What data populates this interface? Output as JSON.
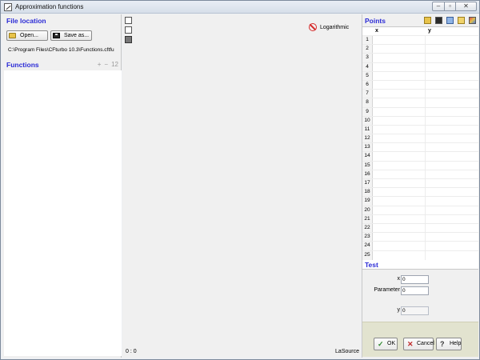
{
  "window": {
    "title": "Approximation functions"
  },
  "file_location": {
    "title": "File location",
    "open_label": "Open...",
    "save_label": "Save as...",
    "path": "C:\\Program Files\\CFturbo 10.3\\Functions.cftfu"
  },
  "functions": {
    "title": "Functions",
    "tools": {
      "add": "+",
      "remove": "−",
      "sort": "12"
    }
  },
  "plot": {
    "log_label": "Logarithmic",
    "coords": "0 : 0",
    "source": "LaSource"
  },
  "points": {
    "title": "Points",
    "col_x": "x",
    "col_y": "y",
    "rows": [
      "1",
      "2",
      "3",
      "4",
      "5",
      "6",
      "7",
      "8",
      "9",
      "10",
      "11",
      "12",
      "13",
      "14",
      "15",
      "16",
      "17",
      "18",
      "19",
      "20",
      "21",
      "22",
      "23",
      "24",
      "25"
    ]
  },
  "test": {
    "title": "Test",
    "x_label": "x",
    "x_value": "0",
    "param_label": "Parameter",
    "param_value": "0",
    "y_label": "y",
    "y_value": "0"
  },
  "dialog": {
    "ok_label": "OK",
    "cancel_label": "Cancel",
    "help_label": "Help"
  },
  "colors": {
    "section_title": "#2b2bd6",
    "bottom_bar": "#e2e3cf"
  }
}
